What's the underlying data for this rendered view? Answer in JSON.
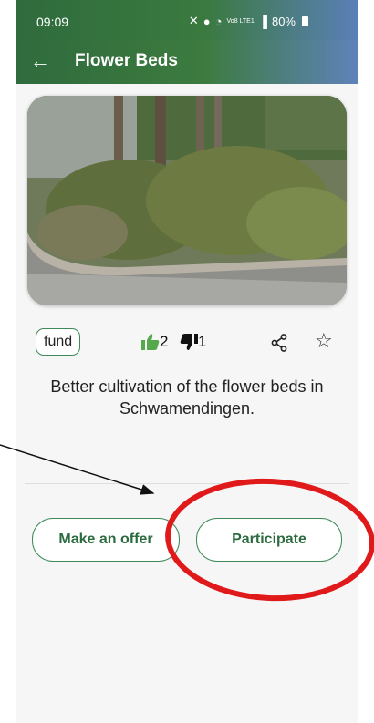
{
  "status_bar": {
    "time": "09:09",
    "network_label": "Vo8 LTE1",
    "battery": "80%"
  },
  "app_bar": {
    "title": "Flower Beds",
    "back_icon": "arrow-left-icon"
  },
  "project": {
    "tag": "fund",
    "upvotes": "2",
    "downvotes": "1",
    "description": "Better cultivation of the flower beds in Schwamendingen."
  },
  "actions": {
    "make_offer_label": "Make an offer",
    "participate_label": "Participate"
  },
  "colors": {
    "accent_green": "#3f8a5a",
    "thumb_up_green": "#55a84b",
    "annotation_red": "#e0191a"
  }
}
